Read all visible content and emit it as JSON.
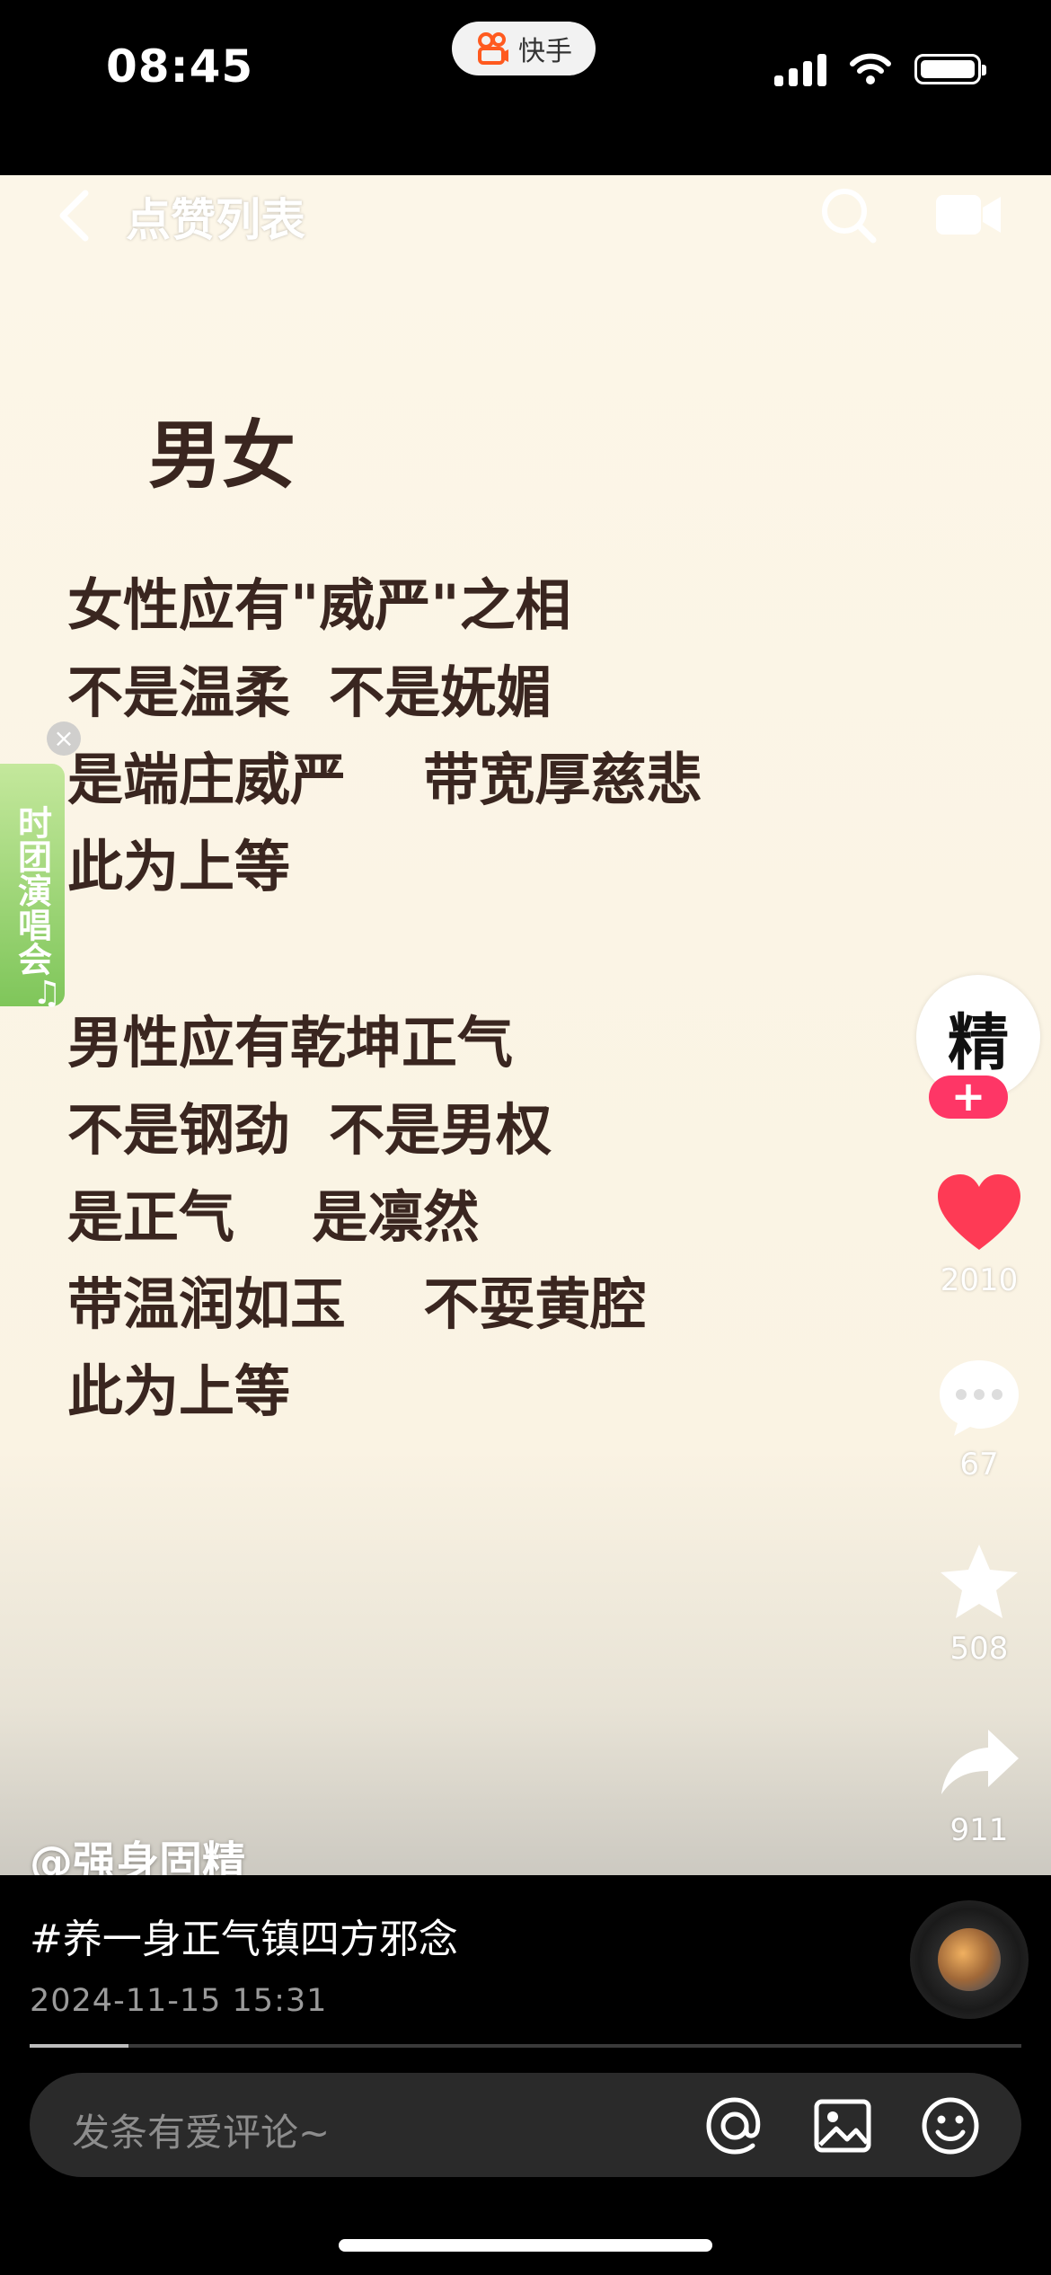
{
  "status_bar": {
    "time": "08:45",
    "app_name": "快手"
  },
  "nav": {
    "title": "点赞列表",
    "back_icon": "chevron-left-icon",
    "search_icon": "search-icon",
    "camera_icon": "camera-icon"
  },
  "post": {
    "heading": "男女",
    "stanza1": "女性应有\"威严\"之相\n不是温柔  不是妩媚\n是端庄威严    带宽厚慈悲\n此为上等",
    "stanza2": "男性应有乾坤正气\n不是钢劲  不是男权\n是正气    是凛然\n带温润如玉    不耍黄腔\n此为上等",
    "author": "@强身固精",
    "caption": "#养一身正气镇四方邪念",
    "date": "2024-11-15 15:31",
    "progress": 0.1
  },
  "side_banner": {
    "text": "时团演唱会"
  },
  "rail": {
    "avatar_text": "精",
    "likes": "2010",
    "comments": "67",
    "favorites": "508",
    "shares": "911",
    "like_color": "#fe3a55"
  },
  "comment_bar": {
    "placeholder": "发条有爱评论~"
  }
}
